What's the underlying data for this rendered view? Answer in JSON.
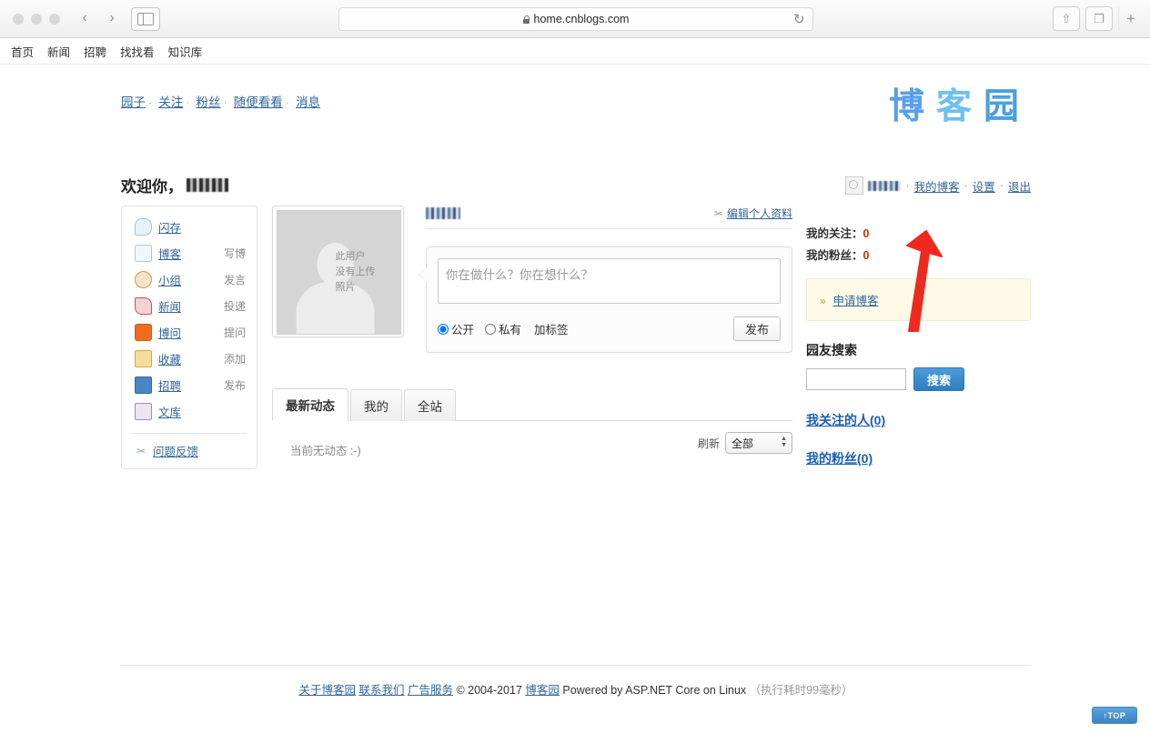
{
  "browser": {
    "url": "home.cnblogs.com",
    "lock_icon": "lock-icon",
    "back_icon": "‹",
    "forward_icon": "›",
    "reload_icon": "↻",
    "share_icon": "⇧",
    "tabs_icon": "❐",
    "newtab_icon": "+"
  },
  "site_nav": {
    "items": [
      "首页",
      "新闻",
      "招聘",
      "找找看",
      "知识库"
    ]
  },
  "header": {
    "top_links": [
      "园子",
      "关注",
      "粉丝",
      "随便看看",
      "消息"
    ],
    "separator": "·",
    "logo": [
      "博",
      "客",
      "园"
    ],
    "logo_colors": [
      "#5aa0e6",
      "#6ec0ef",
      "#4a9fe0"
    ],
    "welcome_text": "欢迎你，",
    "welcome_username_redacted": true,
    "user_links": [
      "我的博客",
      "设置",
      "退出"
    ]
  },
  "sidebar": {
    "items": [
      {
        "label": "闪存",
        "action": "",
        "icon": "chat-bubble-icon",
        "color": "#4f9fd8"
      },
      {
        "label": "博客",
        "action": "写博",
        "icon": "pencil-note-icon",
        "color": "#8fb8d8"
      },
      {
        "label": "小组",
        "action": "发言",
        "icon": "group-people-icon",
        "color": "#d08a3a"
      },
      {
        "label": "新闻",
        "action": "投递",
        "icon": "newspaper-icon",
        "color": "#d0455a"
      },
      {
        "label": "博问",
        "action": "提问",
        "icon": "question-q-icon",
        "color": "#ef6b1f"
      },
      {
        "label": "收藏",
        "action": "添加",
        "icon": "star-folder-icon",
        "color": "#e8b43a"
      },
      {
        "label": "招聘",
        "action": "发布",
        "icon": "briefcase-icon",
        "color": "#3f7fc1"
      },
      {
        "label": "文库",
        "action": "",
        "icon": "book-icon",
        "color": "#9a7bc0"
      }
    ],
    "feedback": {
      "label": "问题反馈",
      "icon": "wrench-icon"
    }
  },
  "profile": {
    "avatar_placeholder_lines": [
      "此用户",
      "没有上传",
      "照片"
    ],
    "edit_profile_label": "编辑个人资料",
    "edit_profile_icon": "wrench-icon",
    "username_redacted": true
  },
  "status_box": {
    "placeholder": "你在做什么？你在想什么？",
    "value": "",
    "radio_public": "公开",
    "radio_private": "私有",
    "radio_selected": "公开",
    "tag_label": "加标签",
    "publish_label": "发布"
  },
  "feed": {
    "tabs": [
      {
        "label": "最新动态",
        "active": true
      },
      {
        "label": "我的",
        "active": false
      },
      {
        "label": "全站",
        "active": false
      }
    ],
    "refresh_label": "刷新",
    "filter_selected": "全部",
    "filter_options": [
      "全部"
    ],
    "empty_text": "当前无动态 :-)"
  },
  "right_panel": {
    "following_label": "我的关注：",
    "following_count": "0",
    "followers_label": "我的粉丝：",
    "followers_count": "0",
    "count_color": "#cc3300",
    "apply_blog_label": "申请博客",
    "apply_chevron": "»",
    "search_title": "园友搜索",
    "search_value": "",
    "search_button": "搜索",
    "link_following": "我关注的人(0)",
    "link_followers": "我的粉丝(0)"
  },
  "footer": {
    "links": [
      "关于博客园",
      "联系我们",
      "广告服务"
    ],
    "copyright": "© 2004-2017",
    "brand_link": "博客园",
    "powered_by": "Powered by ASP.NET Core on Linux",
    "exec_time": "（执行耗时99毫秒）"
  },
  "top_button": {
    "label": "↑TOP"
  },
  "annotation": {
    "type": "red-arrow",
    "color": "#ee2a1e",
    "points_to": "我的博客"
  }
}
